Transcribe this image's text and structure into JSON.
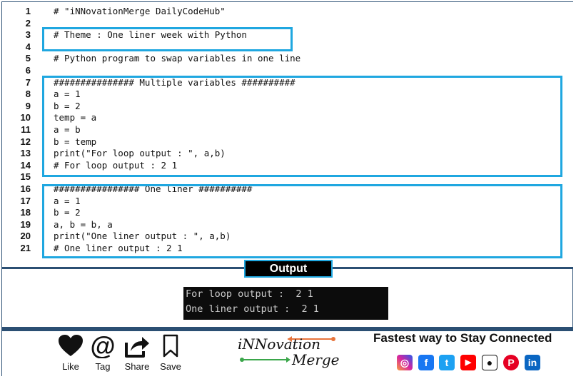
{
  "code": {
    "lines": [
      {
        "n": "1",
        "text": "# \"iNNovationMerge DailyCodeHub\""
      },
      {
        "n": "2",
        "text": ""
      },
      {
        "n": "3",
        "text": "# Theme : One liner week with Python"
      },
      {
        "n": "4",
        "text": ""
      },
      {
        "n": "5",
        "text": "# Python program to swap variables in one line"
      },
      {
        "n": "6",
        "text": ""
      },
      {
        "n": "7",
        "text": "############### Multiple variables ##########"
      },
      {
        "n": "8",
        "text": "a = 1"
      },
      {
        "n": "9",
        "text": "b = 2"
      },
      {
        "n": "10",
        "text": "temp = a"
      },
      {
        "n": "11",
        "text": "a = b"
      },
      {
        "n": "12",
        "text": "b = temp"
      },
      {
        "n": "13",
        "text": "print(\"For loop output : \", a,b)"
      },
      {
        "n": "14",
        "text": "# For loop output : 2 1"
      },
      {
        "n": "15",
        "text": ""
      },
      {
        "n": "16",
        "text": "################ One liner ##########"
      },
      {
        "n": "17",
        "text": "a = 1"
      },
      {
        "n": "18",
        "text": "b = 2"
      },
      {
        "n": "19",
        "text": "a, b = b, a"
      },
      {
        "n": "20",
        "text": "print(\"One liner output : \", a,b)"
      },
      {
        "n": "21",
        "text": "# One liner output : 2 1"
      }
    ]
  },
  "output": {
    "title": "Output",
    "line1": "For loop output :  2 1",
    "line2": "One liner output :  2 1"
  },
  "footer": {
    "like": "Like",
    "tag": "Tag",
    "share": "Share",
    "save": "Save",
    "logo_main": "iNNovation",
    "logo_sub": "Merge",
    "tagline": "Fastest way to Stay Connected"
  },
  "colors": {
    "accent": "#1fa7e0",
    "frame": "#2b4f73",
    "terminal_bg": "#0c0c0c",
    "instagram": "#d6249f",
    "facebook": "#1877f2",
    "twitter": "#1da1f2",
    "youtube": "#ff0000",
    "pinterest": "#e60023",
    "linkedin": "#0a66c2"
  },
  "icons": [
    "heart-icon",
    "at-icon",
    "share-icon",
    "bookmark-icon",
    "instagram-icon",
    "facebook-icon",
    "twitter-icon",
    "youtube-icon",
    "github-icon",
    "pinterest-icon",
    "linkedin-icon"
  ]
}
